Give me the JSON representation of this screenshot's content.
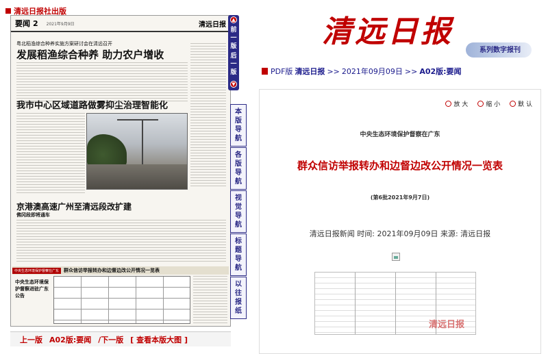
{
  "publisher": "清远日报社出版",
  "paper": {
    "section": "要闻",
    "page_no": "2",
    "date": "2021年9月9日",
    "masthead": "清远日报",
    "headline_small": "粤北稻渔综合种养实施方案研讨会在清远召开",
    "headline_1": "发展稻渔综合种养  助力农户增收",
    "headline_2": "我市中心区域道路做雾抑尘治理智能化",
    "headline_3": "京港澳高速广州至清远段改扩建",
    "headline_3_sub": "佛冈段即将通车",
    "ad_tag": "中央生态环境保护督察在广东",
    "ad_title": "群众信访举报转办和边督边改公开情况一览表",
    "side_box": "中央生态环境保护督察进驻广东公告"
  },
  "nav": {
    "prev_page_short": "前一版",
    "next_page_short": "后一版",
    "tabs": [
      "本版导航",
      "各版导航",
      "视觉导航",
      "标题导航",
      "以往报纸"
    ]
  },
  "bottom_nav": {
    "prev": "上一版",
    "current": "A02版:要闻",
    "next": "/下一版",
    "view_large": "[ 查看本版大图 ]"
  },
  "brand": {
    "title": "清远日报",
    "subtitle": "系列数字报刊"
  },
  "breadcrumb": {
    "pdf": "PDF版",
    "paper": "清远日报",
    "sep1": ">>",
    "date": "2021年09月09日",
    "sep2": ">>",
    "page": "A02版:要闻"
  },
  "tools": {
    "zoom_in": "放 大",
    "zoom_out": "缩 小",
    "default": "默 认"
  },
  "article": {
    "kicker": "中央生态环境保护督察在广东",
    "title": "群众信访举报转办和边督边改公开情况一览表",
    "subtitle": "(第6批2021年9月7日)",
    "meta": "清远日报新闻 时间: 2021年09月09日 来源: 清远日报",
    "watermark": "清远日报"
  }
}
